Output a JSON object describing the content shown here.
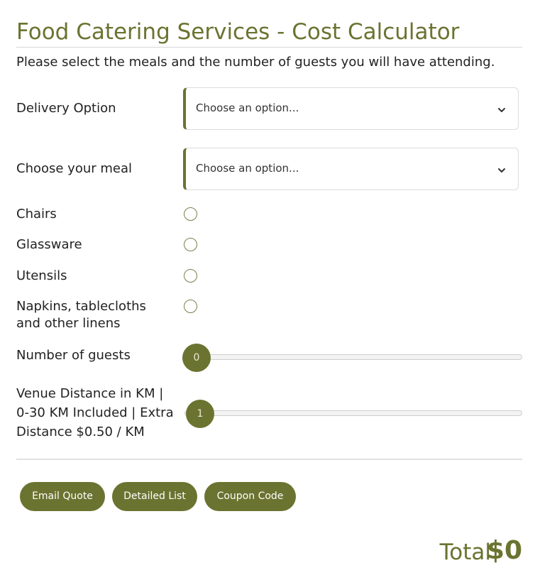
{
  "calculator": {
    "title": "Food Catering Services - Cost Calculator",
    "intro": "Please select the meals and the number of guests you will have attending."
  },
  "fields": {
    "delivery_option": {
      "label": "Delivery Option",
      "selected": "Choose an option..."
    },
    "meal": {
      "label": "Choose your meal",
      "selected": "Choose an option..."
    },
    "chairs": {
      "label": "Chairs",
      "checked": false
    },
    "glassware": {
      "label": "Glassware",
      "checked": false
    },
    "utensils": {
      "label": "Utensils",
      "checked": false
    },
    "linens": {
      "label": "Napkins, tablecloths and other linens",
      "checked": false
    },
    "guests": {
      "label": "Number of guests",
      "value": "0"
    },
    "distance": {
      "label": "Venue Distance in KM | 0-30 KM Included | Extra Distance $0.50 / KM",
      "value": "1"
    }
  },
  "actions": {
    "email_quote": "Email Quote",
    "detailed_list": "Detailed List",
    "coupon_code": "Coupon Code"
  },
  "total": {
    "label": "Total",
    "value": "$0"
  },
  "icons": {
    "dropdown": "chevron-down-icon"
  },
  "colors": {
    "accent": "#6b7330"
  }
}
